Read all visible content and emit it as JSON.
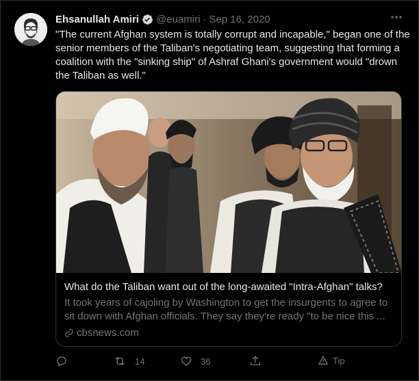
{
  "tweet": {
    "author_name": "Ehsanullah Amiri",
    "handle": "@euamiri",
    "separator": "·",
    "date": "Sep 16, 2020",
    "text": "\"The current Afghan system is totally corrupt and incapable,\" began one of the senior members of the Taliban's negotiating team, suggesting that forming a coalition with the \"sinking ship\" of Ashraf Ghani's government would \"drown the Taliban as well.\"",
    "more_icon": "more-dots-icon"
  },
  "card": {
    "title": "What do the Taliban want out of the long-awaited \"Intra-Afghan\" talks?",
    "description": "It took years of cajoling by Washington to get the insurgents to agree to sit down with Afghan officials. They say they're ready \"to be nice this ...",
    "domain": "cbsnews.com"
  },
  "actions": {
    "reply_count": "",
    "retweet_count": "14",
    "like_count": "36",
    "tip_label": "Tip"
  },
  "colors": {
    "background": "#000000",
    "text": "#e7e9ea",
    "muted": "#71767b",
    "verified": "#1d9bf0",
    "border": "#2f3336"
  }
}
